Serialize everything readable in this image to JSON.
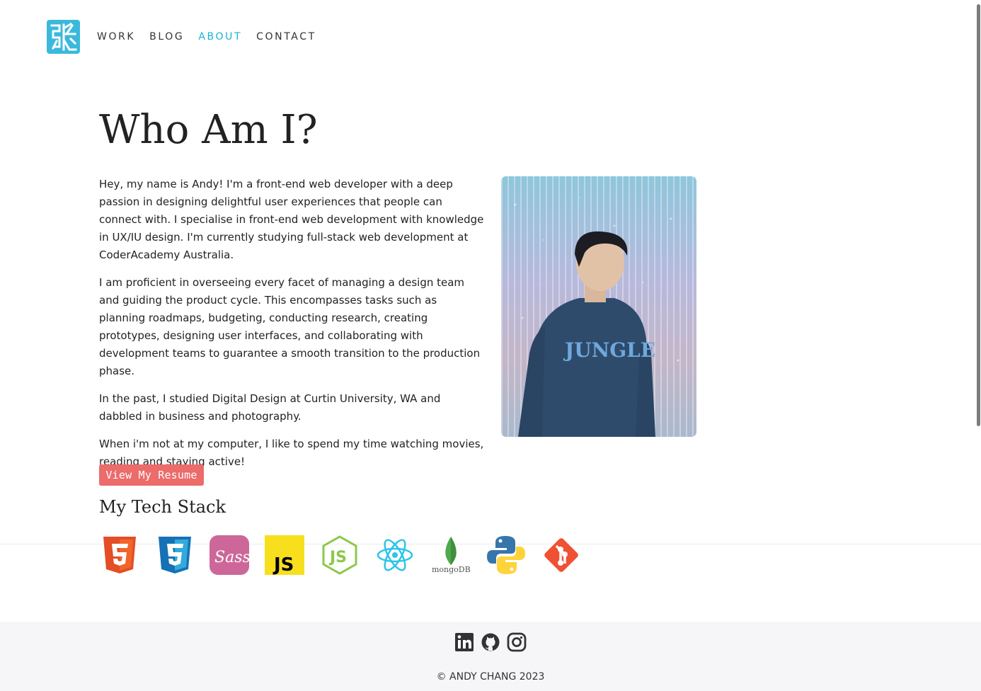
{
  "nav": {
    "logo_icon": "zhang-character-logo-icon",
    "items": [
      {
        "label": "WORK",
        "active": false
      },
      {
        "label": "BLOG",
        "active": false
      },
      {
        "label": "ABOUT",
        "active": true
      },
      {
        "label": "CONTACT",
        "active": false
      }
    ],
    "accent_color": "#1ab3d3"
  },
  "about": {
    "title": "Who Am I?",
    "paragraphs": [
      "Hey, my name is Andy! I'm a front-end web developer with a deep passion in designing delightful user experiences that people can connect with. I specialise in front-end web development with knowledge in UX/IU design. I'm currently studying full-stack web development at CoderAcademy Australia.",
      "I am proficient in overseeing every facet of managing a design team and guiding the product cycle. This encompasses tasks such as planning roadmaps, budgeting, conducting research, creating prototypes, designing user interfaces, and collaborating with development teams to guarantee a smooth transition to the production phase.",
      "In the past, I studied Digital Design at Curtin University, WA and dabbled in business and photography.",
      "When i'm not at my computer, I like to spend my time watching movies, reading and staying active!"
    ],
    "photo": "portrait-photo",
    "resume_button": "View My Resume",
    "resume_color": "#ec6b6b"
  },
  "tech_stack": {
    "title": "My Tech Stack",
    "icons": [
      "html5-icon",
      "css3-icon",
      "sass-icon",
      "javascript-icon",
      "nodejs-icon",
      "react-icon",
      "mongodb-icon",
      "python-icon",
      "git-icon"
    ],
    "mongodb_label": "mongoDB",
    "js_label": "JS"
  },
  "footer": {
    "social_icons": [
      "linkedin-icon",
      "github-icon",
      "instagram-icon"
    ],
    "copyright": "© ANDY CHANG 2023"
  }
}
